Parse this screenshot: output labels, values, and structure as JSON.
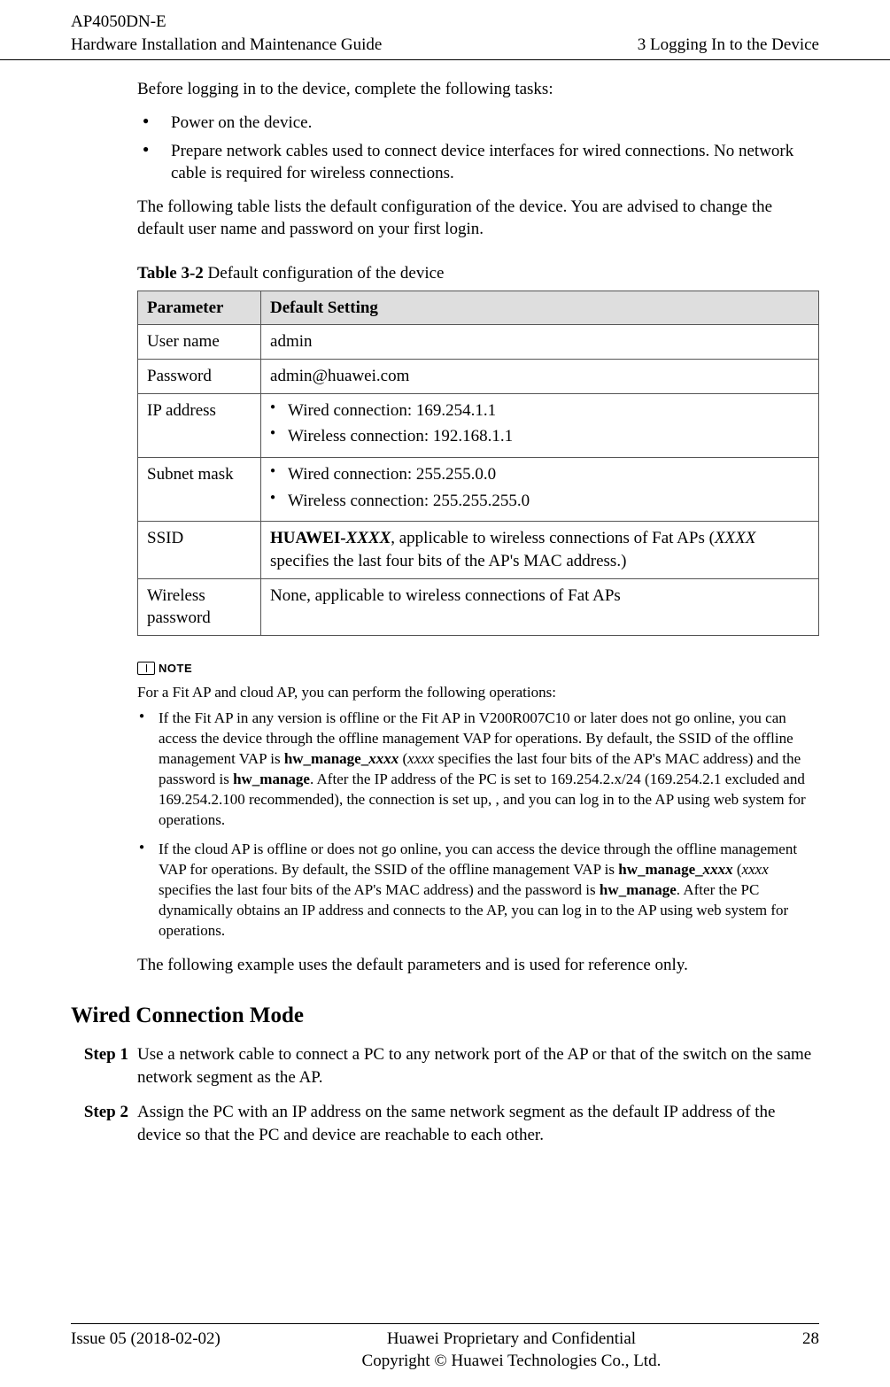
{
  "header": {
    "product": "AP4050DN-E",
    "doc_title": "Hardware Installation and Maintenance Guide",
    "chapter": "3 Logging In to the Device"
  },
  "intro": {
    "lead": "Before logging in to the device, complete the following tasks:",
    "bullets": [
      "Power on the device.",
      "Prepare network cables used to connect device interfaces for wired connections. No network cable is required for wireless connections."
    ],
    "tablelead": "The following table lists the default configuration of the device. You are advised to change the default user name and password on your first login."
  },
  "table": {
    "caption_prefix": "Table 3-2",
    "caption_text": " Default configuration of the device",
    "col1": "Parameter",
    "col2": "Default Setting",
    "rows": {
      "username": {
        "param": "User name",
        "value": "admin"
      },
      "password": {
        "param": "Password",
        "value": "admin@huawei.com"
      },
      "ip": {
        "param": "IP address",
        "wired": "Wired connection: 169.254.1.1",
        "wireless": "Wireless connection: 192.168.1.1"
      },
      "subnet": {
        "param": "Subnet mask",
        "wired": "Wired connection: 255.255.0.0",
        "wireless": "Wireless connection: 255.255.255.0"
      },
      "ssid": {
        "param": "SSID",
        "bold": "HUAWEI-",
        "bolditalic": "XXXX",
        "rest1": ", applicable to wireless connections of Fat APs (",
        "italic": "XXXX",
        "rest2": " specifies the last four bits of the AP's MAC address.)"
      },
      "wpass": {
        "param": "Wireless password",
        "value": "None, applicable to wireless connections of Fat APs"
      }
    }
  },
  "note": {
    "label": "NOTE",
    "lead": "For a Fit AP and cloud AP, you can perform the following operations:",
    "items": [
      {
        "p1": "If the Fit AP in any version is offline or the Fit AP in V200R007C10 or later does not go online, you can access the device through the offline management VAP for operations. By default, the SSID of the offline management VAP is ",
        "b1": "hw_manage_",
        "bi1": "xxxx",
        "p2": " (",
        "i1": "xxxx",
        "p3": " specifies the last four bits of the AP's MAC address) and the password is ",
        "b2": "hw_manage",
        "p4": ". After the IP address of the PC is set to 169.254.2.x/24 (169.254.2.1 excluded and 169.254.2.100 recommended), the connection is set up, , and you can log in to the AP using web system for operations."
      },
      {
        "p1": "If the cloud AP is offline or does not go online, you can access the device through the offline management VAP for operations. By default, the SSID of the offline management VAP is ",
        "b1": "hw_manage_",
        "bi1": "xxxx",
        "p2": " (",
        "i1": "xxxx",
        "p3": " specifies the last four bits of the AP's MAC address) and the password is ",
        "b2": "hw_manage",
        "p4": ". After the PC dynamically obtains an IP address and connects to the AP, you can log in to the AP using web system for operations."
      }
    ],
    "after": "The following example uses the default parameters and is used for reference only."
  },
  "wired": {
    "heading": "Wired Connection Mode",
    "steps": [
      {
        "label": "Step 1",
        "text": "Use a network cable to connect a PC to any network port of the AP or that of the switch on the same network segment as the AP."
      },
      {
        "label": "Step 2",
        "text": "Assign the PC with an IP address on the same network segment as the default IP address of the device so that the PC and device are reachable to each other."
      }
    ]
  },
  "footer": {
    "issue": "Issue 05 (2018-02-02)",
    "line1": "Huawei Proprietary and Confidential",
    "line2": "Copyright © Huawei Technologies Co., Ltd.",
    "page": "28"
  }
}
